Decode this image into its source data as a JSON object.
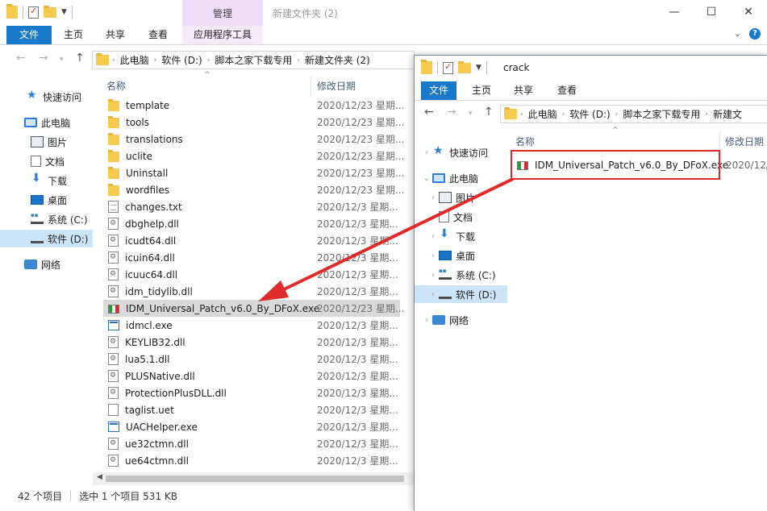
{
  "left_window": {
    "title": "新建文件夹 (2)",
    "context_tab": "管理",
    "ribbon_tabs": [
      "文件",
      "主页",
      "共享",
      "查看",
      "应用程序工具"
    ],
    "breadcrumb": [
      "此电脑",
      "软件 (D:)",
      "脚本之家下载专用",
      "新建文件夹 (2)"
    ],
    "nav_items": [
      {
        "label": "快速访问",
        "icon": "star-icon"
      },
      {
        "label": "此电脑",
        "icon": "pc-icon"
      },
      {
        "label": "图片",
        "icon": "pictures-icon"
      },
      {
        "label": "文档",
        "icon": "documents-icon"
      },
      {
        "label": "下载",
        "icon": "download-icon"
      },
      {
        "label": "桌面",
        "icon": "desktop-icon"
      },
      {
        "label": "系统 (C:)",
        "icon": "drive-c-icon"
      },
      {
        "label": "软件 (D:)",
        "icon": "drive-d-icon"
      },
      {
        "label": "网络",
        "icon": "network-icon"
      }
    ],
    "columns": {
      "name": "名称",
      "date": "修改日期"
    },
    "files": [
      {
        "name": "template",
        "type": "folder",
        "date": "2020/12/23 星期..."
      },
      {
        "name": "tools",
        "type": "folder",
        "date": "2020/12/23 星期..."
      },
      {
        "name": "translations",
        "type": "folder",
        "date": "2020/12/23 星期..."
      },
      {
        "name": "uclite",
        "type": "folder",
        "date": "2020/12/23 星期..."
      },
      {
        "name": "Uninstall",
        "type": "folder",
        "date": "2020/12/23 星期..."
      },
      {
        "name": "wordfiles",
        "type": "folder",
        "date": "2020/12/23 星期..."
      },
      {
        "name": "changes.txt",
        "type": "txt",
        "date": "2020/12/3 星期..."
      },
      {
        "name": "dbghelp.dll",
        "type": "dll",
        "date": "2020/12/3 星期..."
      },
      {
        "name": "icudt64.dll",
        "type": "dll",
        "date": "2020/12/3 星期..."
      },
      {
        "name": "icuin64.dll",
        "type": "dll",
        "date": "2020/12/3 星期..."
      },
      {
        "name": "icuuc64.dll",
        "type": "dll",
        "date": "2020/12/3 星期..."
      },
      {
        "name": "idm_tidylib.dll",
        "type": "dll",
        "date": "2020/12/3 星期..."
      },
      {
        "name": "IDM_Universal_Patch_v6.0_By_DFoX.exe",
        "type": "flag",
        "date": "2020/12/23 星期..."
      },
      {
        "name": "idmcl.exe",
        "type": "exe",
        "date": "2020/12/3 星期..."
      },
      {
        "name": "KEYLIB32.dll",
        "type": "dll",
        "date": "2020/12/3 星期..."
      },
      {
        "name": "lua5.1.dll",
        "type": "dll",
        "date": "2020/12/3 星期..."
      },
      {
        "name": "PLUSNative.dll",
        "type": "dll",
        "date": "2020/12/3 星期..."
      },
      {
        "name": "ProtectionPlusDLL.dll",
        "type": "dll",
        "date": "2020/12/3 星期..."
      },
      {
        "name": "taglist.uet",
        "type": "blank",
        "date": "2020/12/3 星期..."
      },
      {
        "name": "UACHelper.exe",
        "type": "exe",
        "date": "2020/12/3 星期..."
      },
      {
        "name": "ue32ctmn.dll",
        "type": "dll",
        "date": "2020/12/3 星期..."
      },
      {
        "name": "ue64ctmn.dll",
        "type": "dll",
        "date": "2020/12/3 星期..."
      }
    ],
    "status": {
      "count": "42 个项目",
      "selection": "选中 1 个项目 531 KB"
    }
  },
  "right_window": {
    "title": "crack",
    "ribbon_tabs": [
      "文件",
      "主页",
      "共享",
      "查看"
    ],
    "breadcrumb": [
      "此电脑",
      "软件 (D:)",
      "脚本之家下载专用",
      "新建文"
    ],
    "nav_items": [
      {
        "label": "快速访问",
        "icon": "star-icon"
      },
      {
        "label": "此电脑",
        "icon": "pc-icon"
      },
      {
        "label": "图片",
        "icon": "pictures-icon"
      },
      {
        "label": "文档",
        "icon": "documents-icon"
      },
      {
        "label": "下载",
        "icon": "download-icon"
      },
      {
        "label": "桌面",
        "icon": "desktop-icon"
      },
      {
        "label": "系统 (C:)",
        "icon": "drive-c-icon"
      },
      {
        "label": "软件 (D:)",
        "icon": "drive-d-icon"
      },
      {
        "label": "网络",
        "icon": "network-icon"
      }
    ],
    "columns": {
      "name": "名称",
      "date": "修改日期"
    },
    "files": [
      {
        "name": "IDM_Universal_Patch_v6.0_By_DFoX.exe",
        "type": "flag",
        "date": "2020/12/"
      }
    ]
  },
  "colors": {
    "accent": "#1979ca",
    "highlight": "#e02b2b",
    "context_tab": "#eddcf7"
  }
}
